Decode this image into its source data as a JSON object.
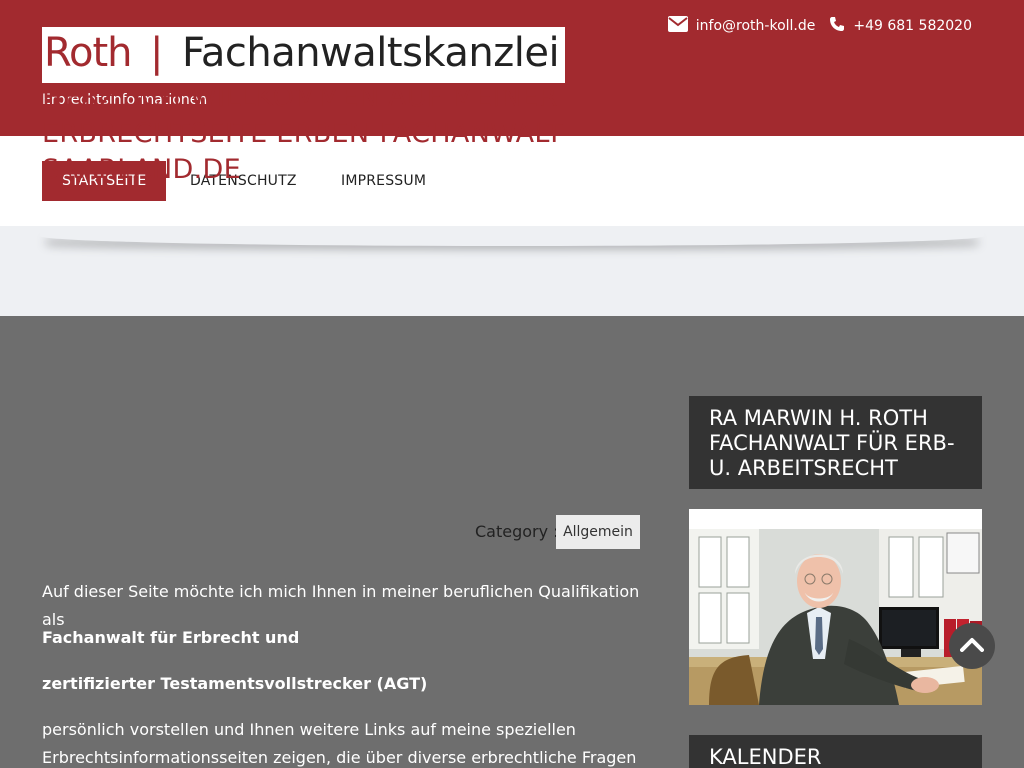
{
  "header": {
    "logo_roth": "Roth",
    "logo_separator": "|",
    "logo_name": "Fachanwaltskanzlei",
    "tagline": "Erbrechtsinformationen",
    "email": "info@roth-koll.de",
    "phone": "+49 681 582020",
    "email_icon": "envelope-icon",
    "phone_icon": "phone-icon"
  },
  "nav": {
    "items": [
      {
        "label": "STARTSEITE",
        "active": true
      },
      {
        "label": "DATENSCHUTZ",
        "active": false
      },
      {
        "label": "IMPRESSUM",
        "active": false
      }
    ]
  },
  "post": {
    "title": "HERZLICH WILLKOMMEN AUF MEINER ERBRECHTSEITE ERBEN-FACHANWALT-SAARLAND.DE",
    "category_label": "Category :",
    "category_value": "Allgemein",
    "p1": "Auf dieser Seite möchte ich mich Ihnen in meiner beruflichen Qualifikation als",
    "p2": "Fachanwalt für Erbrecht und",
    "p3": "zertifizierter Testamentsvollstrecker (AGT)",
    "p4a": "persönlich vorstellen und Ihnen weitere Links auf meine speziellen",
    "p4b": "Erbrechtsinformationsseiten zeigen, die über diverse erbrechtliche Fragen und"
  },
  "sidebar": {
    "widget1_title": "RA MARWIN H. ROTH FACHANWALT FÜR ERB- U. ARBEITSRECHT",
    "widget2_title": "KALENDER"
  },
  "colors": {
    "brand": "#a22a2f",
    "dark": "#333333",
    "background": "#6e6e6e"
  },
  "icons": {
    "scroll_top": "chevron-up-icon"
  }
}
